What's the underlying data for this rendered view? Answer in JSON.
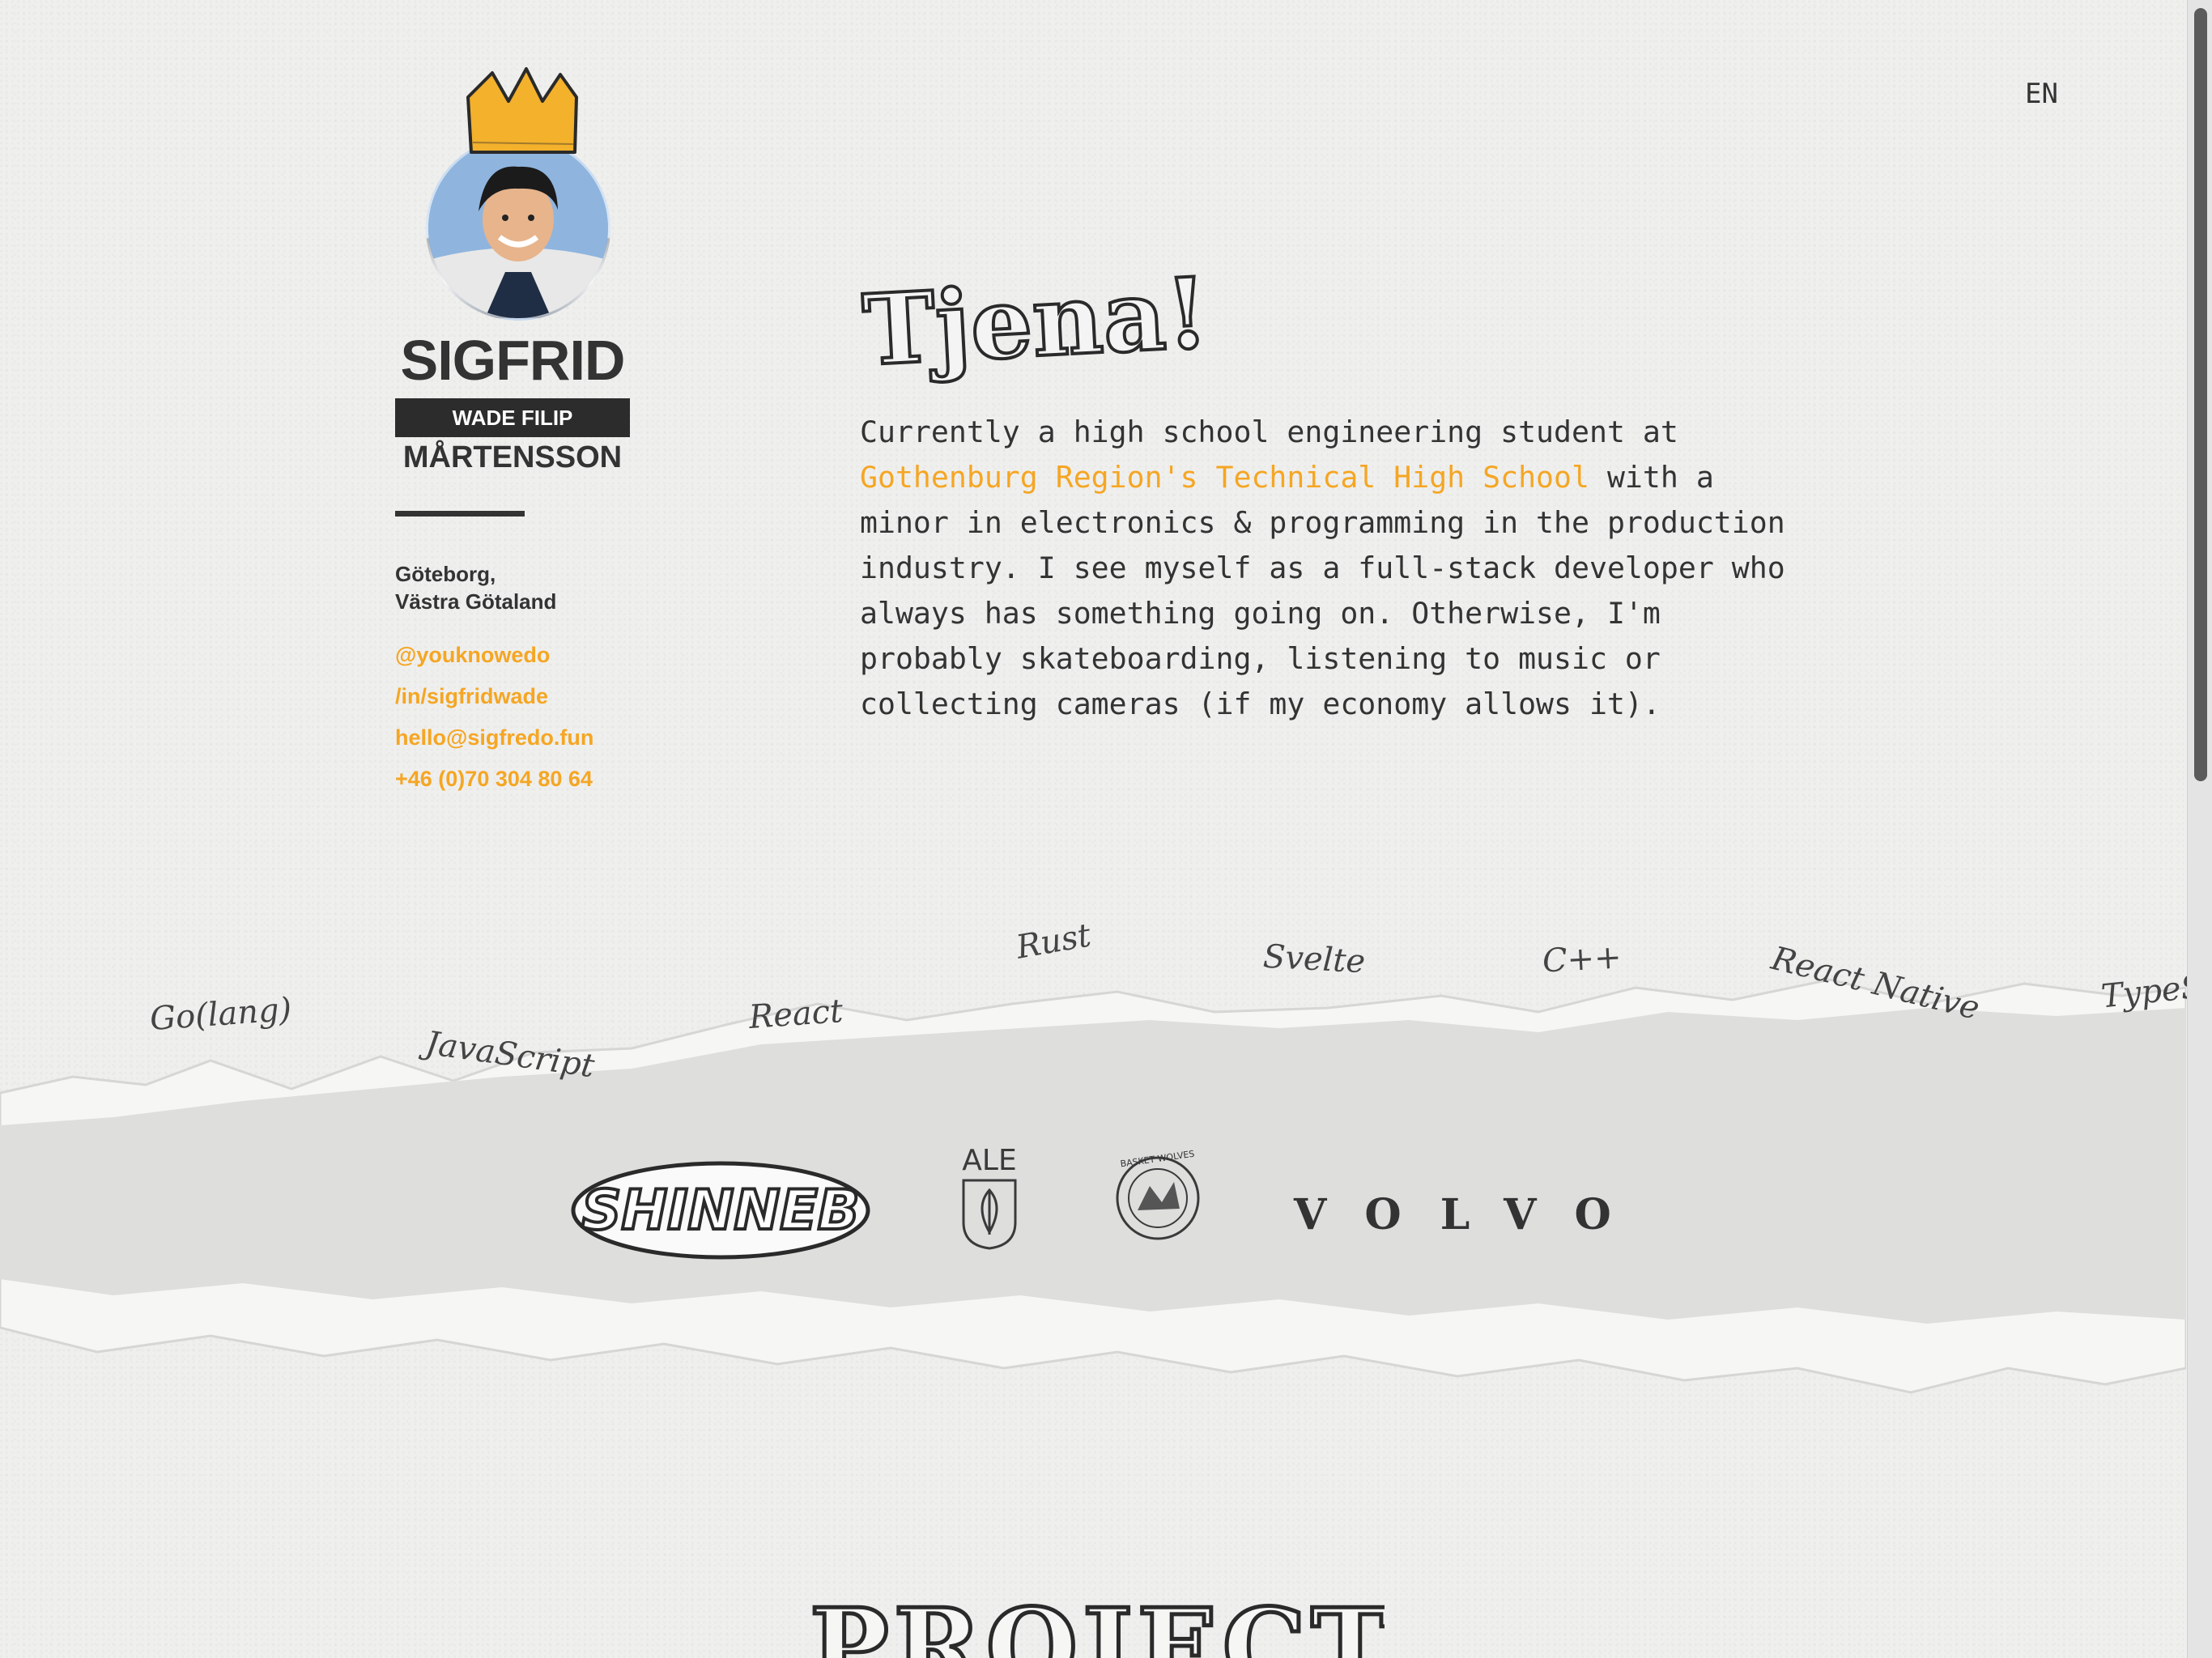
{
  "header": {
    "language": "EN"
  },
  "profile": {
    "first_name": "SIGFRID",
    "middle_name": "WADE FILIP",
    "last_name": "MÅRTENSSON",
    "location_line1": "Göteborg,",
    "location_line2": "Västra Götaland",
    "links": [
      "@youknowedo",
      "/in/sigfridwade",
      "hello@sigfredo.fun",
      "+46 (0)70 304 80 64"
    ]
  },
  "intro": {
    "greeting": "Tjena!",
    "bio_before": "Currently a high school engineering student at ",
    "school": "Gothenburg Region's Technical High School",
    "bio_after": " with a minor in electronics & programming in the production industry. I see myself as a full-stack developer who always has something going on. Otherwise, I'm probably skateboarding, listening to music or collecting cameras (if my economy allows it)."
  },
  "skills": [
    "Go(lang)",
    "JavaScript",
    "React",
    "Rust",
    "Svelte",
    "C++",
    "React Native",
    "TypeS"
  ],
  "clients": [
    "SHINNEB",
    "ALE",
    "BASKET WOLVES",
    "VOLVO"
  ],
  "sections": {
    "projects_title": "PROJECTS"
  },
  "colors": {
    "accent": "#f5a623",
    "ink": "#333333",
    "paper": "#efefee"
  }
}
